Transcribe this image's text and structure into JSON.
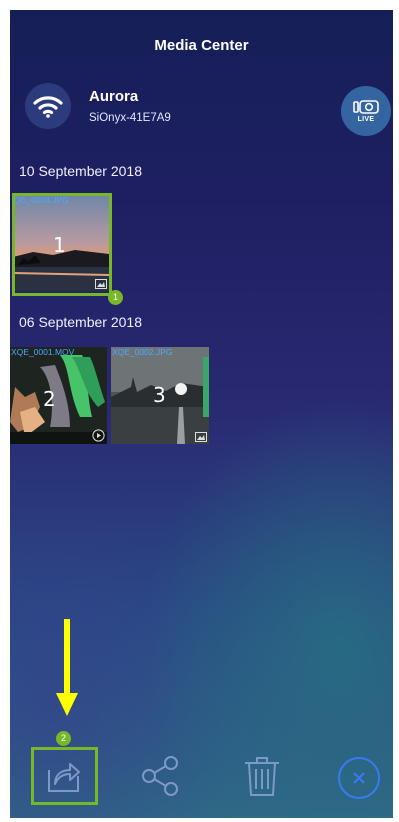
{
  "header": {
    "title": "Media Center"
  },
  "connection": {
    "name": "Aurora",
    "id": "SiOnyx-41E7A9",
    "wifi_icon": "wifi-icon"
  },
  "live": {
    "label": "LIVE",
    "icon": "camera-icon"
  },
  "groups": [
    {
      "date": "10 September 2018",
      "items": [
        {
          "filename": "QE_0004.JPG",
          "number": "1",
          "type": "photo",
          "selected": true,
          "badge": "1"
        }
      ]
    },
    {
      "date": "06 September 2018",
      "items": [
        {
          "filename": "XQE_0001.MOV",
          "number": "2",
          "type": "video",
          "selected": false
        },
        {
          "filename": "XQE_0002.JPG",
          "number": "3",
          "type": "photo",
          "selected": false
        }
      ]
    }
  ],
  "toolbar": {
    "export_badge": "2",
    "buttons": [
      "export-icon",
      "share-icon",
      "trash-icon",
      "close-icon"
    ]
  },
  "colors": {
    "accent": "#78b828",
    "annotation_arrow": "#ffff00",
    "filename": "#4aa8ff"
  }
}
